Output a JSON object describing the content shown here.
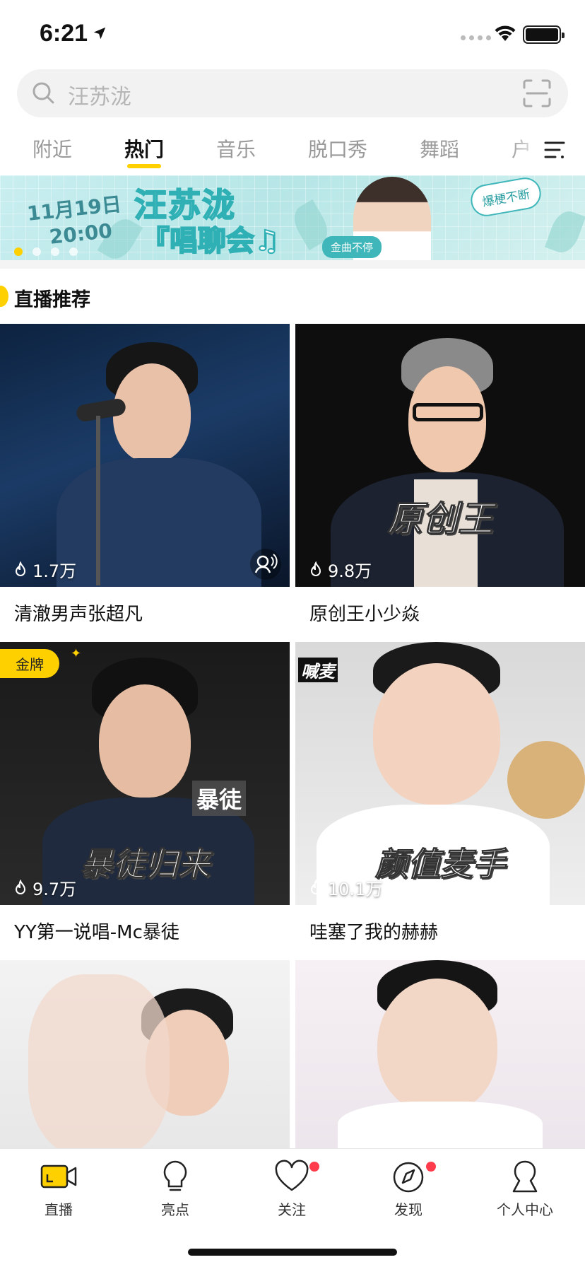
{
  "status_bar": {
    "time": "6:21"
  },
  "search": {
    "placeholder": "汪苏泷"
  },
  "tabs": [
    {
      "label": "附近",
      "active": false
    },
    {
      "label": "热门",
      "active": true
    },
    {
      "label": "音乐",
      "active": false
    },
    {
      "label": "脱口秀",
      "active": false
    },
    {
      "label": "舞蹈",
      "active": false
    },
    {
      "label": "户",
      "active": false
    }
  ],
  "banner": {
    "date": "11月19日",
    "time": "20:00",
    "title": "汪苏泷",
    "subtitle": "『唱聊会♫",
    "pill": "金曲不停",
    "bubble": "爆梗不断",
    "pages": 4,
    "active_page": 0
  },
  "section": {
    "title": "直播推荐"
  },
  "cards": [
    {
      "name": "清澈男声张超凡",
      "views": "1.7万",
      "overlay": "",
      "badge": "",
      "voice_icon": true
    },
    {
      "name": "原创王小少焱",
      "views": "9.8万",
      "overlay": "原创王",
      "badge": "",
      "voice_icon": false
    },
    {
      "name": "YY第一说唱-Mc暴徒",
      "views": "9.7万",
      "overlay": "暴徒归来",
      "overlay_small": "暴徒",
      "badge": "金牌",
      "voice_icon": false
    },
    {
      "name": "哇塞了我的赫赫",
      "views": "10.1万",
      "overlay": "颜值麦手",
      "corner_text": "喊麦",
      "badge": "",
      "voice_icon": false
    },
    {
      "name": "",
      "views": "",
      "overlay": "",
      "badge": ""
    },
    {
      "name": "",
      "views": "",
      "overlay": "",
      "badge": ""
    }
  ],
  "bottom_nav": [
    {
      "label": "直播",
      "icon": "live-camera-icon",
      "active": true,
      "dot": false
    },
    {
      "label": "亮点",
      "icon": "lightbulb-icon",
      "active": false,
      "dot": false
    },
    {
      "label": "关注",
      "icon": "heart-icon",
      "active": false,
      "dot": true
    },
    {
      "label": "发现",
      "icon": "compass-icon",
      "active": false,
      "dot": true
    },
    {
      "label": "个人中心",
      "icon": "person-icon",
      "active": false,
      "dot": false
    }
  ],
  "colors": {
    "accent": "#ffd000",
    "notify": "#ff3b4c"
  }
}
